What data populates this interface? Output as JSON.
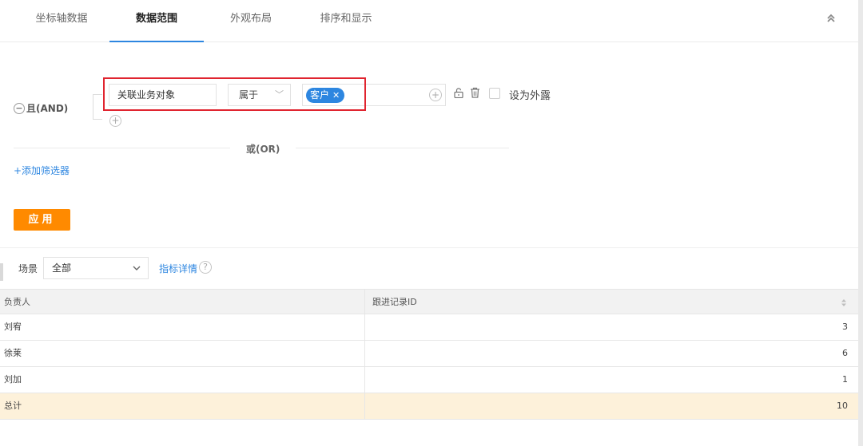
{
  "tabs": [
    "坐标轴数据",
    "数据范围",
    "外观布局",
    "排序和显示"
  ],
  "active_tab": "数据范围",
  "filter": {
    "logic_label": "且(AND)",
    "field": "关联业务对象",
    "operator": "属于",
    "value_tag": "客户",
    "external_label": "设为外露",
    "or_label": "或(OR)",
    "add_filter": "+添加筛选器",
    "apply": "应用"
  },
  "scene": {
    "label": "场景",
    "value": "全部",
    "detail_link": "指标详情"
  },
  "table": {
    "columns": [
      "负责人",
      "跟进记录ID"
    ],
    "rows": [
      [
        "刘宥",
        "3"
      ],
      [
        "徐莱",
        "6"
      ],
      [
        "刘加",
        "1"
      ]
    ],
    "total": [
      "总计",
      "10"
    ]
  },
  "colors": {
    "accent": "#2d86e0",
    "apply": "#ff8a00",
    "highlight": "#e0242f",
    "total_row": "#fdf1da"
  }
}
